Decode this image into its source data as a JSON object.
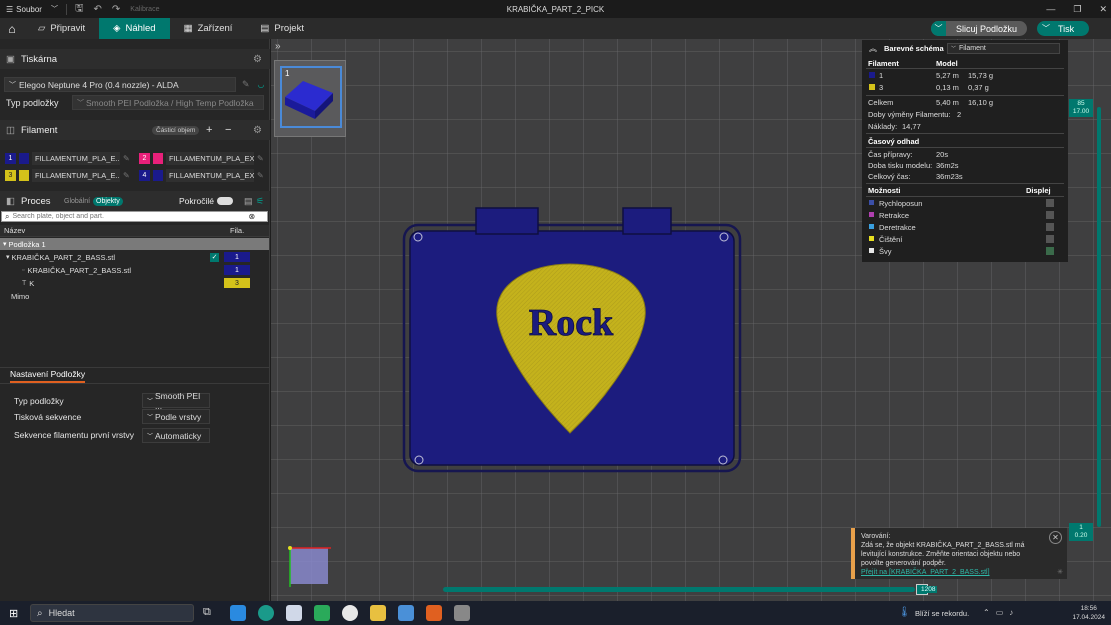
{
  "titlebar": {
    "menu_label": "Soubor",
    "calibration": "Kalibrace",
    "title": "KRABIČKA_PART_2_PICK"
  },
  "nav": {
    "tabs": [
      {
        "label": "Připravit"
      },
      {
        "label": "Náhled"
      },
      {
        "label": "Zařízení"
      },
      {
        "label": "Projekt"
      }
    ],
    "slice_label": "Slicuj Podložku",
    "print_label": "Tisk"
  },
  "printer": {
    "section_title": "Tiskárna",
    "selected": "Elegoo Neptune 4 Pro (0.4 nozzle) - ALDA",
    "plate_type_label": "Typ podložky",
    "plate_type_value": "Smooth PEI Podložka / High Temp Podložka"
  },
  "filament": {
    "section_title": "Filament",
    "part_volume_label": "Částicí objem",
    "items": [
      {
        "num": "1",
        "name": "FILLAMENTUM_PLA_E...",
        "color": "#1a1a8c"
      },
      {
        "num": "2",
        "name": "FILLAMENTUM_PLA_EX...",
        "color": "#e8207a"
      },
      {
        "num": "3",
        "name": "FILLAMENTUM_PLA_E...",
        "color": "#d4c21a"
      },
      {
        "num": "4",
        "name": "FILLAMENTUM_PLA_EX...",
        "color": "#1a1a8c"
      }
    ]
  },
  "process": {
    "section_title": "Proces",
    "global_label": "Globální",
    "objects_label": "Objekty",
    "advanced_label": "Pokročilé",
    "search_placeholder": "Search plate, object and part.",
    "col_name": "Název",
    "col_fila": "Fila.",
    "tree": [
      {
        "label": "Podložka 1",
        "fila": ""
      },
      {
        "label": "KRABIČKA_PART_2_BASS.stl",
        "fila": "1"
      },
      {
        "label": "KRABIČKA_PART_2_BASS.stl",
        "fila": "1"
      },
      {
        "label": "K",
        "fila": "3"
      },
      {
        "label": "Mimo",
        "fila": ""
      }
    ]
  },
  "plate_settings": {
    "tab_label": "Nastavení Podložky",
    "rows": [
      {
        "label": "Typ podložky",
        "value": "Smooth PEI ..."
      },
      {
        "label": "Tisková sekvence",
        "value": "Podle vrstvy"
      },
      {
        "label": "Sekvence filamentu první vrstvy",
        "value": "Automaticky"
      }
    ]
  },
  "viewport": {
    "thumb_num": "1",
    "model_text": "Rock",
    "layer_top": "85",
    "layer_top_height": "17.00",
    "layer_bottom": "1",
    "layer_bottom_height": "0.20",
    "horizontal_value": "1208",
    "colors": {
      "box": "#1c1c7e",
      "pick": "#c4b21c",
      "grid": "#6a6a6c"
    }
  },
  "stats": {
    "scheme_label": "Barevné schéma",
    "scheme_value": "Filament",
    "col_filament": "Filament",
    "col_model": "Model",
    "rows": [
      {
        "id": "1",
        "length": "5,27 m",
        "weight": "15,73 g",
        "color": "#1a1a8c"
      },
      {
        "id": "3",
        "length": "0,13 m",
        "weight": "0,37 g",
        "color": "#d4c21a"
      }
    ],
    "total_label": "Celkem",
    "total_length": "5,40 m",
    "total_weight": "16,10 g",
    "changes_label": "Doby výměny Filamentu:",
    "changes_value": "2",
    "cost_label": "Náklady:",
    "cost_value": "14,77",
    "time_title": "Časový odhad",
    "prep_label": "Čas přípravy:",
    "prep_value": "20s",
    "model_time_label": "Doba tisku modelu:",
    "model_time_value": "36m2s",
    "total_time_label": "Celkový čas:",
    "total_time_value": "36m23s",
    "options_title": "Možnosti",
    "display_title": "Displej",
    "options": [
      {
        "label": "Rychloposun",
        "color": "#3b4fa8"
      },
      {
        "label": "Retrakce",
        "color": "#b040b0"
      },
      {
        "label": "Deretrakce",
        "color": "#3aa0e0"
      },
      {
        "label": "Čištění",
        "color": "#e8e020"
      },
      {
        "label": "Švy",
        "color": "#e8e8e8"
      }
    ]
  },
  "warning": {
    "title": "Varování:",
    "text": "Zdá se, že objekt KRABIČKA_PART_2_BASS.stl má levitující konstrukce. Změňte orientaci objektu nebo povolte generování podpěr.",
    "link": "Přejít na [KRABIČKA_PART_2_BASS.stl]"
  },
  "taskbar": {
    "search_label": "Hledat",
    "weather": "Blíží se rekordu.",
    "time": "18:56",
    "date": "17.04.2024"
  }
}
